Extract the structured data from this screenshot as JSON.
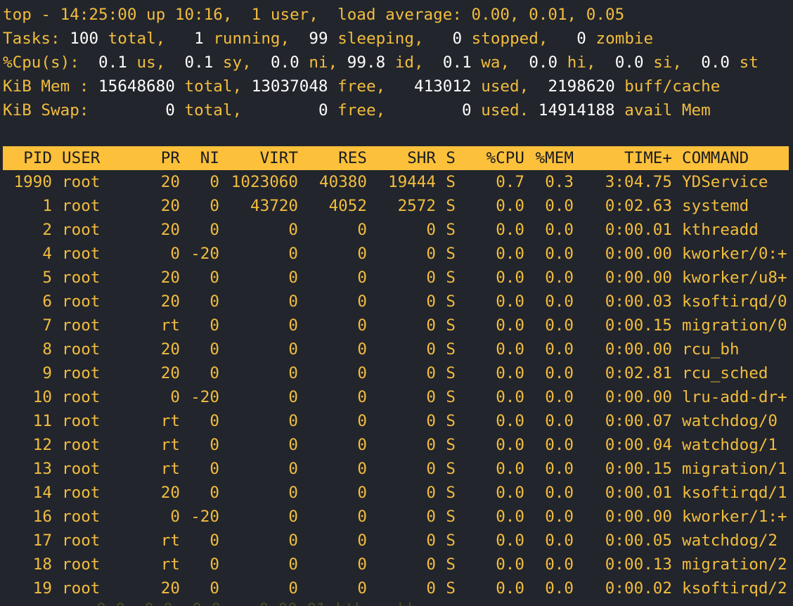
{
  "summary": {
    "line1": "top - 14:25:00 up 10:16,  1 user,  load average: 0.00, 0.01, 0.05",
    "tasks": {
      "label": "Tasks:",
      "total": "100",
      "total_label": "total,",
      "running": "1",
      "running_label": "running,",
      "sleeping": "99",
      "sleeping_label": "sleeping,",
      "stopped": "0",
      "stopped_label": "stopped,",
      "zombie": "0",
      "zombie_label": "zombie"
    },
    "cpu": {
      "label": "%Cpu(s):",
      "us": "0.1",
      "us_label": "us,",
      "sy": "0.1",
      "sy_label": "sy,",
      "ni": "0.0",
      "ni_label": "ni,",
      "id": "99.8",
      "id_label": "id,",
      "wa": "0.1",
      "wa_label": "wa,",
      "hi": "0.0",
      "hi_label": "hi,",
      "si": "0.0",
      "si_label": "si,",
      "st": "0.0",
      "st_label": "st"
    },
    "mem": {
      "label": "KiB Mem :",
      "total": "15648680",
      "total_label": "total,",
      "free": "13037048",
      "free_label": "free,",
      "used": "413012",
      "used_label": "used,",
      "buff": "2198620",
      "buff_label": "buff/cache"
    },
    "swap": {
      "label": "KiB Swap:",
      "total": "0",
      "total_label": "total,",
      "free": "0",
      "free_label": "free,",
      "used": "0",
      "used_label": "used.",
      "avail": "14914188",
      "avail_label": "avail Mem"
    }
  },
  "table": {
    "headers": [
      "PID",
      "USER",
      "PR",
      "NI",
      "VIRT",
      "RES",
      "SHR",
      "S",
      "%CPU",
      "%MEM",
      "TIME+",
      "COMMAND"
    ],
    "rows": [
      [
        "1990",
        "root",
        "20",
        "0",
        "1023060",
        "40380",
        "19444",
        "S",
        "0.7",
        "0.3",
        "3:04.75",
        "YDService"
      ],
      [
        "1",
        "root",
        "20",
        "0",
        "43720",
        "4052",
        "2572",
        "S",
        "0.0",
        "0.0",
        "0:02.63",
        "systemd"
      ],
      [
        "2",
        "root",
        "20",
        "0",
        "0",
        "0",
        "0",
        "S",
        "0.0",
        "0.0",
        "0:00.01",
        "kthreadd"
      ],
      [
        "4",
        "root",
        "0",
        "-20",
        "0",
        "0",
        "0",
        "S",
        "0.0",
        "0.0",
        "0:00.00",
        "kworker/0:+"
      ],
      [
        "5",
        "root",
        "20",
        "0",
        "0",
        "0",
        "0",
        "S",
        "0.0",
        "0.0",
        "0:00.00",
        "kworker/u8+"
      ],
      [
        "6",
        "root",
        "20",
        "0",
        "0",
        "0",
        "0",
        "S",
        "0.0",
        "0.0",
        "0:00.03",
        "ksoftirqd/0"
      ],
      [
        "7",
        "root",
        "rt",
        "0",
        "0",
        "0",
        "0",
        "S",
        "0.0",
        "0.0",
        "0:00.15",
        "migration/0"
      ],
      [
        "8",
        "root",
        "20",
        "0",
        "0",
        "0",
        "0",
        "S",
        "0.0",
        "0.0",
        "0:00.00",
        "rcu_bh"
      ],
      [
        "9",
        "root",
        "20",
        "0",
        "0",
        "0",
        "0",
        "S",
        "0.0",
        "0.0",
        "0:02.81",
        "rcu_sched"
      ],
      [
        "10",
        "root",
        "0",
        "-20",
        "0",
        "0",
        "0",
        "S",
        "0.0",
        "0.0",
        "0:00.00",
        "lru-add-dr+"
      ],
      [
        "11",
        "root",
        "rt",
        "0",
        "0",
        "0",
        "0",
        "S",
        "0.0",
        "0.0",
        "0:00.07",
        "watchdog/0"
      ],
      [
        "12",
        "root",
        "rt",
        "0",
        "0",
        "0",
        "0",
        "S",
        "0.0",
        "0.0",
        "0:00.04",
        "watchdog/1"
      ],
      [
        "13",
        "root",
        "rt",
        "0",
        "0",
        "0",
        "0",
        "S",
        "0.0",
        "0.0",
        "0:00.15",
        "migration/1"
      ],
      [
        "14",
        "root",
        "20",
        "0",
        "0",
        "0",
        "0",
        "S",
        "0.0",
        "0.0",
        "0:00.01",
        "ksoftirqd/1"
      ],
      [
        "16",
        "root",
        "0",
        "-20",
        "0",
        "0",
        "0",
        "S",
        "0.0",
        "0.0",
        "0:00.00",
        "kworker/1:+"
      ],
      [
        "17",
        "root",
        "rt",
        "0",
        "0",
        "0",
        "0",
        "S",
        "0.0",
        "0.0",
        "0:00.05",
        "watchdog/2"
      ],
      [
        "18",
        "root",
        "rt",
        "0",
        "0",
        "0",
        "0",
        "S",
        "0.0",
        "0.0",
        "0:00.13",
        "migration/2"
      ],
      [
        "19",
        "root",
        "20",
        "0",
        "0",
        "0",
        "0",
        "S",
        "0.0",
        "0.0",
        "0:00.02",
        "ksoftirqd/2"
      ]
    ]
  },
  "colors": {
    "background": "#22252c",
    "text": "#f2bd3e",
    "highlight": "#ffffff",
    "header_bg": "#fcc03a",
    "header_text": "#1a1c22"
  }
}
